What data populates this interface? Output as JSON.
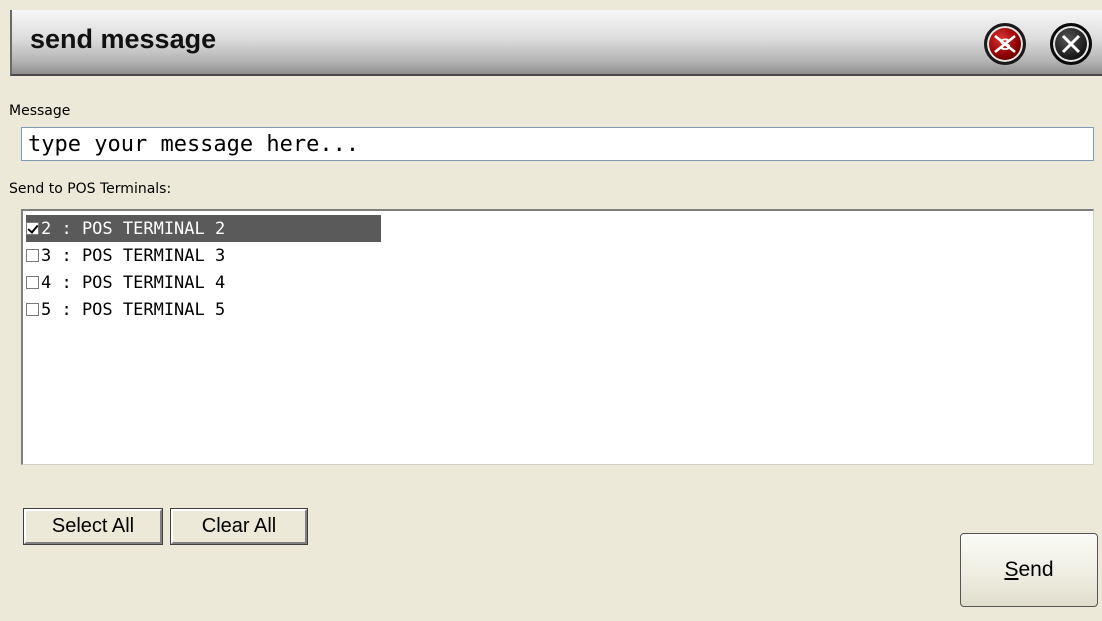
{
  "window": {
    "title": "send message",
    "special_button_letter": "S"
  },
  "message": {
    "label": "Message",
    "value": "type your message here..."
  },
  "terminals": {
    "label": "Send to POS Terminals:",
    "items": [
      {
        "label": "2 : POS TERMINAL 2",
        "checked": true,
        "selected": true
      },
      {
        "label": "3 : POS TERMINAL 3",
        "checked": false,
        "selected": false
      },
      {
        "label": "4 : POS TERMINAL 4",
        "checked": false,
        "selected": false
      },
      {
        "label": "5 : POS TERMINAL 5",
        "checked": false,
        "selected": false
      }
    ]
  },
  "buttons": {
    "select_all": "Select All",
    "clear_all": "Clear All",
    "send": "Send"
  },
  "colors": {
    "window_background": "#ece9d8",
    "selection_background": "#5a5a5a",
    "special_button": "#b00000"
  },
  "icons": {
    "special_button": "s-mark-icon",
    "close_button": "close-icon"
  }
}
